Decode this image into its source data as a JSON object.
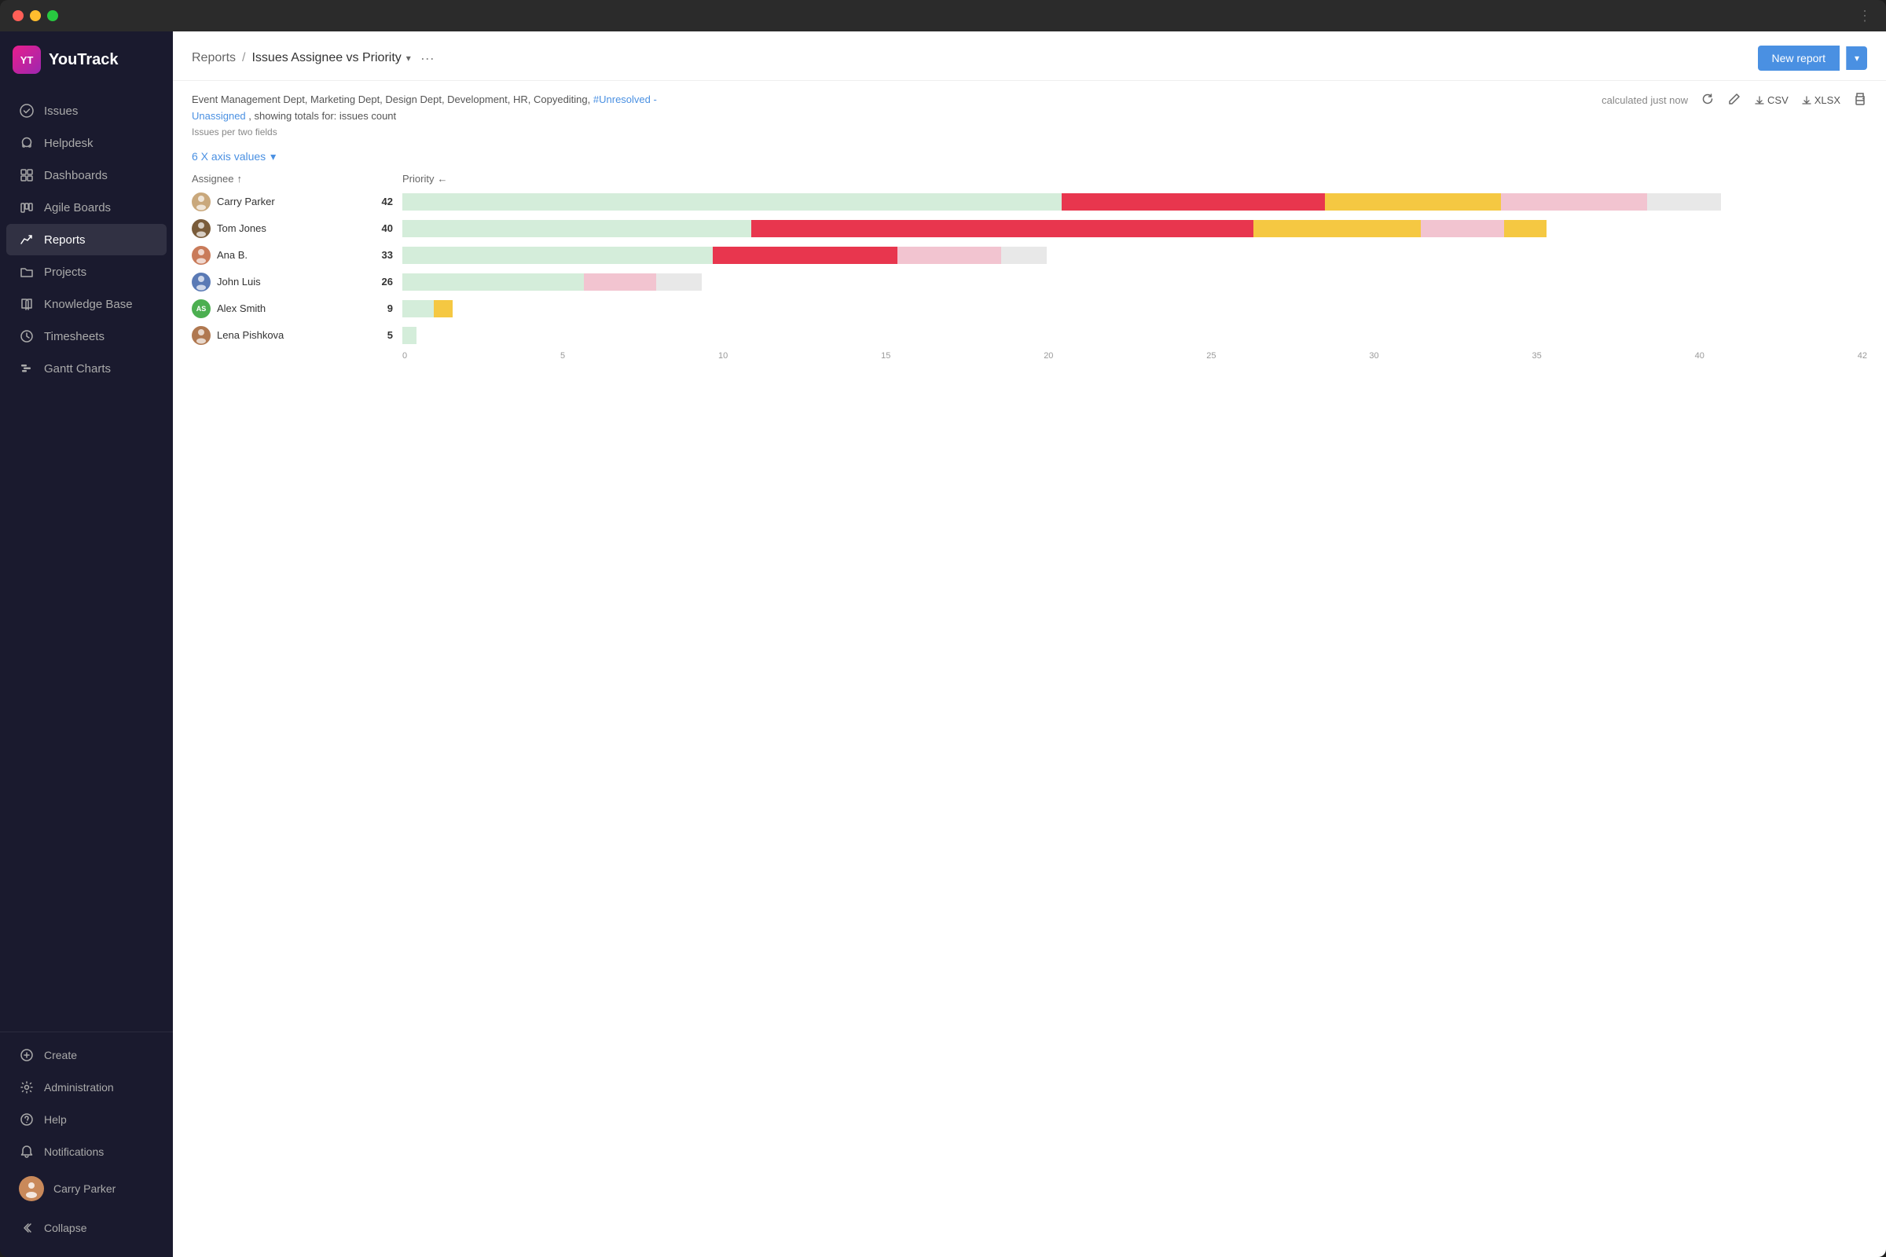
{
  "window": {
    "title": "YouTrack"
  },
  "logo": {
    "abbr": "YT",
    "name": "YouTrack"
  },
  "sidebar": {
    "nav_items": [
      {
        "id": "issues",
        "label": "Issues",
        "icon": "check-circle"
      },
      {
        "id": "helpdesk",
        "label": "Helpdesk",
        "icon": "headset"
      },
      {
        "id": "dashboards",
        "label": "Dashboards",
        "icon": "grid"
      },
      {
        "id": "agile",
        "label": "Agile Boards",
        "icon": "columns"
      },
      {
        "id": "reports",
        "label": "Reports",
        "icon": "chart",
        "active": true
      },
      {
        "id": "projects",
        "label": "Projects",
        "icon": "folder"
      },
      {
        "id": "knowledge",
        "label": "Knowledge Base",
        "icon": "book"
      },
      {
        "id": "timesheets",
        "label": "Timesheets",
        "icon": "clock"
      },
      {
        "id": "gantt",
        "label": "Gantt Charts",
        "icon": "gantt"
      }
    ],
    "bottom_items": [
      {
        "id": "create",
        "label": "Create",
        "icon": "plus"
      },
      {
        "id": "admin",
        "label": "Administration",
        "icon": "gear"
      },
      {
        "id": "help",
        "label": "Help",
        "icon": "question"
      },
      {
        "id": "notifications",
        "label": "Notifications",
        "icon": "bell"
      },
      {
        "id": "user",
        "label": "Carry Parker",
        "icon": "avatar"
      }
    ],
    "collapse_label": "Collapse"
  },
  "header": {
    "breadcrumb_link": "Reports",
    "breadcrumb_sep": "/",
    "report_title": "Issues Assignee vs Priority",
    "more_dots": "···",
    "new_report_label": "New report"
  },
  "report": {
    "filters": "Event Management Dept, Marketing Dept, Design Dept, Development, HR, Copyediting,",
    "filter_highlight": "#Unresolved -Unassigned",
    "filter_suffix": ", showing totals for: issues count",
    "subtitle": "Issues per two fields",
    "calc_time": "calculated just now",
    "axis_values_label": "6 X axis values"
  },
  "chart": {
    "col_assignee": "Assignee",
    "col_priority": "Priority",
    "assignee_sort": "↑",
    "priority_arrow": "←",
    "rows": [
      {
        "name": "Carry Parker",
        "count": 42,
        "avatar_color": "#c9a87c",
        "segments": [
          {
            "color": "#d4edda",
            "width_pct": 30
          },
          {
            "color": "#d4edda",
            "width_pct": 15
          },
          {
            "color": "#e8364e",
            "width_pct": 18
          },
          {
            "color": "#f5c842",
            "width_pct": 12
          },
          {
            "color": "#f2c4d0",
            "width_pct": 10
          },
          {
            "color": "#e8e8e8",
            "width_pct": 5
          }
        ]
      },
      {
        "name": "Tom Jones",
        "count": 40,
        "avatar_color": "#7a5c3a",
        "segments": [
          {
            "color": "#d4edda",
            "width_pct": 25
          },
          {
            "color": "#e8364e",
            "width_pct": 18
          },
          {
            "color": "#e8364e",
            "width_pct": 18
          },
          {
            "color": "#f5c842",
            "width_pct": 12
          },
          {
            "color": "#f2c4d0",
            "width_pct": 6
          },
          {
            "color": "#f5c842",
            "width_pct": 3
          }
        ]
      },
      {
        "name": "Ana B.",
        "count": 33,
        "avatar_color": "#c97b5a",
        "segments": [
          {
            "color": "#d4edda",
            "width_pct": 27
          },
          {
            "color": "#e8364e",
            "width_pct": 16
          },
          {
            "color": "#f2c4d0",
            "width_pct": 9
          },
          {
            "color": "#e8e8e8",
            "width_pct": 4
          }
        ]
      },
      {
        "name": "John Luis",
        "count": 26,
        "avatar_color": "#5a7ab5",
        "segments": [
          {
            "color": "#d4edda",
            "width_pct": 20
          },
          {
            "color": "#f2c4d0",
            "width_pct": 8
          },
          {
            "color": "#e8e8e8",
            "width_pct": 5
          }
        ]
      },
      {
        "name": "Alex Smith",
        "count": 9,
        "avatar_color": "#4caf50",
        "avatar_initials": "AS",
        "segments": [
          {
            "color": "#d4edda",
            "width_pct": 10
          },
          {
            "color": "#f5c842",
            "width_pct": 6
          }
        ]
      },
      {
        "name": "Lena Pishkova",
        "count": 5,
        "avatar_color": "#b07850",
        "segments": [
          {
            "color": "#d4edda",
            "width_pct": 8
          }
        ]
      }
    ],
    "x_axis_labels": [
      "0",
      "5",
      "10",
      "15",
      "20",
      "25",
      "30",
      "35",
      "40",
      "42"
    ],
    "max_value": 42
  }
}
